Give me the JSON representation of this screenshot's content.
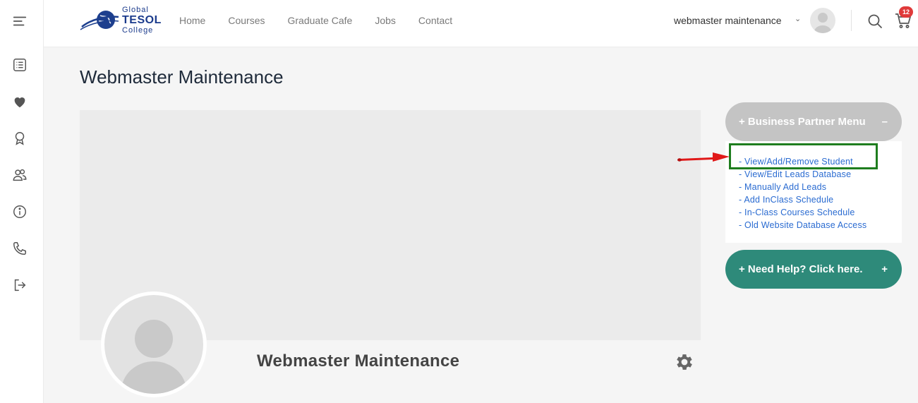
{
  "logo": {
    "line1": "Global",
    "line2": "TESOL",
    "line3": "College"
  },
  "nav": [
    {
      "label": "Home"
    },
    {
      "label": "Courses"
    },
    {
      "label": "Graduate Cafe"
    },
    {
      "label": "Jobs"
    },
    {
      "label": "Contact"
    }
  ],
  "user": {
    "name": "webmaster maintenance"
  },
  "cart": {
    "count": "12"
  },
  "page": {
    "title": "Webmaster Maintenance"
  },
  "profile": {
    "name": "Webmaster Maintenance"
  },
  "business_menu": {
    "label": "+ Business Partner Menu",
    "toggle": "–",
    "links": [
      "- View/Add/Remove Student",
      "- View/Edit Leads Database",
      "- Manually Add Leads",
      "- Add InClass Schedule",
      "- In-Class Courses Schedule",
      "- Old Website Database Access"
    ]
  },
  "help": {
    "label": "+ Need Help? Click here.",
    "toggle": "+"
  },
  "sidebar": {
    "icons": [
      "menu-icon",
      "list-icon",
      "heart-icon",
      "award-icon",
      "users-icon",
      "info-icon",
      "phone-icon",
      "logout-icon"
    ]
  },
  "colors": {
    "accent_green": "#2e8a7a",
    "menu_gray": "#c4c4c4",
    "link_blue": "#2a6bd1",
    "highlight_green": "#1e7d1e",
    "arrow_red": "#e01818",
    "badge_red": "#e03a3a"
  }
}
